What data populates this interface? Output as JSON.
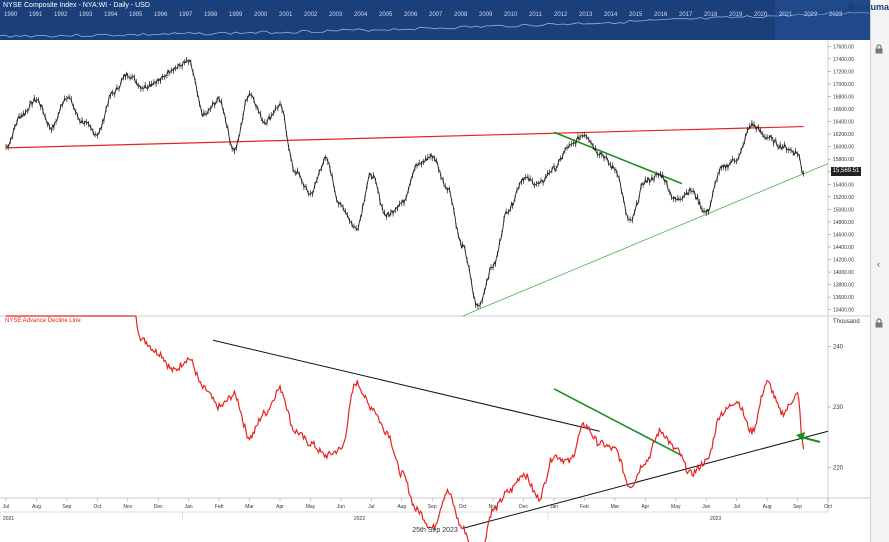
{
  "navigator": {
    "title": "NYSE Composite Index - NYA:WI - Daily - USD",
    "years": [
      "1990",
      "1991",
      "1992",
      "1993",
      "1994",
      "1995",
      "1996",
      "1997",
      "1998",
      "1999",
      "2000",
      "2001",
      "2002",
      "2003",
      "2004",
      "2005",
      "2006",
      "2007",
      "2008",
      "2009",
      "2010",
      "2011",
      "2012",
      "2013",
      "2014",
      "2015",
      "2016",
      "2017",
      "2018",
      "2019",
      "2020",
      "2021",
      "2022",
      "2023"
    ]
  },
  "logo_text": "Optuma",
  "current_price_label": "15,569.51",
  "lower_panel_label": "NYSE Advance Decline Line",
  "lower_unit": "Thousand",
  "date_label": "25th Sep 2023",
  "colors": {
    "price": "#222222",
    "adline": "#e52421",
    "resistance": "#e52421",
    "uptrend_upper": "#4caf50",
    "downtrend": "#1e8c1e",
    "ad_trend": "#111111",
    "arrow": "#1e8c1e",
    "navigator_bg": "#1b3f7a"
  },
  "chart_data": [
    {
      "type": "line",
      "name": "NYSE Composite Index - NYA:WI - Daily - USD",
      "y_ticks": [
        "13400.00",
        "13600.00",
        "13800.00",
        "14000.00",
        "14200.00",
        "14400.00",
        "14600.00",
        "14800.00",
        "15000.00",
        "15200.00",
        "15400.00",
        "15600.00",
        "15800.00",
        "16000.00",
        "16200.00",
        "16400.00",
        "16600.00",
        "16800.00",
        "17000.00",
        "17200.00",
        "17400.00",
        "17600.00"
      ],
      "ylim": [
        13300,
        17700
      ],
      "x_months": [
        "Jul",
        "Aug",
        "Sep",
        "Oct",
        "Nov",
        "Dec",
        "Jan",
        "Feb",
        "Mar",
        "Apr",
        "May",
        "Jun",
        "Jul",
        "Aug",
        "Sep",
        "Oct",
        "Nov",
        "Dec",
        "Jan",
        "Feb",
        "Mar",
        "Apr",
        "May",
        "Jun",
        "Jul",
        "Aug",
        "Sep",
        "Oct"
      ],
      "x_years": [
        "2021",
        "2022",
        "2023"
      ],
      "x": [
        0,
        0.5,
        1,
        1.5,
        2,
        2.5,
        3,
        3.5,
        4,
        4.5,
        5,
        5.5,
        6,
        6.5,
        7,
        7.5,
        8,
        8.5,
        9,
        9.5,
        10,
        10.5,
        11,
        11.5,
        12,
        12.5,
        13,
        13.5,
        14,
        14.5,
        15,
        15.5,
        16,
        16.5,
        17,
        17.5,
        18,
        18.5,
        19,
        19.5,
        20,
        20.5,
        21,
        21.5,
        22,
        22.5,
        23,
        23.5,
        24,
        24.5,
        25,
        25.5,
        26,
        26.2
      ],
      "values": [
        16000,
        16500,
        16750,
        16300,
        16800,
        16400,
        16200,
        16850,
        17150,
        16950,
        17050,
        17250,
        17350,
        16500,
        16750,
        15950,
        16850,
        16400,
        16650,
        15600,
        15250,
        15800,
        15050,
        14700,
        15550,
        14900,
        15100,
        15700,
        15850,
        15350,
        14400,
        13450,
        14100,
        15000,
        15500,
        15400,
        15650,
        16000,
        16200,
        15900,
        15650,
        14800,
        15450,
        15550,
        15150,
        15300,
        14950,
        15650,
        15800,
        16350,
        16150,
        16000,
        15900,
        15570
      ],
      "lines": [
        {
          "name": "resistance",
          "x": [
            0,
            26.2
          ],
          "values": [
            15980,
            16320
          ]
        },
        {
          "name": "rising-support",
          "x": [
            15,
            27
          ],
          "values": [
            13300,
            15730
          ]
        },
        {
          "name": "falling-trend",
          "x": [
            18,
            22.2
          ],
          "values": [
            16230,
            15410
          ]
        }
      ]
    },
    {
      "type": "line",
      "name": "NYSE Advance Decline Line",
      "unit": "Thousand",
      "y_ticks": [
        "220",
        "230",
        "240"
      ],
      "ylim": [
        215,
        245
      ],
      "x": [
        0,
        0.5,
        1,
        1.5,
        2,
        2.5,
        3,
        3.5,
        4,
        4.5,
        5,
        5.5,
        6,
        6.5,
        7,
        7.5,
        8,
        8.5,
        9,
        9.5,
        10,
        10.5,
        11,
        11.5,
        12,
        12.5,
        13,
        13.5,
        14,
        14.5,
        15,
        15.5,
        16,
        16.5,
        17,
        17.5,
        18,
        18.5,
        19,
        19.5,
        20,
        20.5,
        21,
        21.5,
        22,
        22.5,
        23,
        23.5,
        24,
        24.5,
        25,
        25.5,
        26,
        26.2
      ],
      "values": [
        252,
        254,
        253,
        255,
        250,
        253,
        248,
        251,
        249,
        241,
        239,
        236,
        238,
        233,
        230,
        232,
        225,
        229,
        233,
        226,
        224,
        222,
        223,
        234,
        230,
        226,
        219,
        213,
        210,
        216,
        210,
        204,
        213,
        216,
        219,
        215,
        222,
        221,
        227,
        224,
        223,
        217,
        221,
        226,
        223,
        219,
        221,
        229,
        231,
        226,
        234,
        229,
        232,
        223
      ],
      "lines": [
        {
          "name": "descending-resistance",
          "x": [
            6.8,
            19.5
          ],
          "values": [
            241,
            226
          ]
        },
        {
          "name": "rising-support",
          "x": [
            15,
            27
          ],
          "values": [
            210,
            226
          ]
        },
        {
          "name": "falling-trend",
          "x": [
            18,
            22.2
          ],
          "values": [
            233,
            222
          ]
        }
      ]
    }
  ]
}
